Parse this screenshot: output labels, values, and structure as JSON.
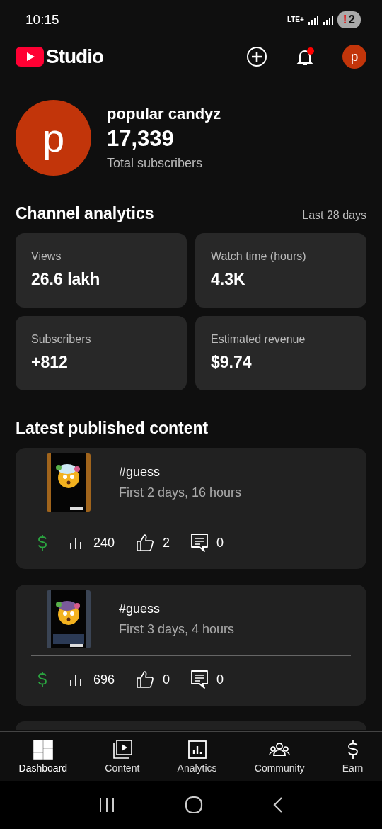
{
  "status_bar": {
    "time": "10:15",
    "network": "LTE+",
    "alert_mark": "!",
    "alert_count": "2"
  },
  "app_bar": {
    "title": "Studio",
    "avatar_letter": "p",
    "notification_dot": true
  },
  "channel": {
    "avatar_letter": "p",
    "name": "popular candyz",
    "subscribers": "17,339",
    "subscribers_label": "Total subscribers"
  },
  "analytics": {
    "title": "Channel analytics",
    "period": "Last 28 days",
    "metrics": [
      {
        "label": "Views",
        "value": "26.6 lakh"
      },
      {
        "label": "Watch time (hours)",
        "value": "4.3K"
      },
      {
        "label": "Subscribers",
        "value": "+812"
      },
      {
        "label": "Estimated revenue",
        "value": "$9.74"
      }
    ]
  },
  "latest": {
    "title": "Latest published content",
    "items": [
      {
        "kind": "picture",
        "title": "#guess",
        "period": "First 2 days, 16 hours",
        "views": "240",
        "likes": "2",
        "comments": "0"
      },
      {
        "kind": "picture",
        "title": "#guess",
        "period": "First 3 days, 4 hours",
        "views": "696",
        "likes": "0",
        "comments": "0"
      }
    ]
  },
  "bottom_nav": [
    {
      "label": "Dashboard",
      "selected": true
    },
    {
      "label": "Content",
      "selected": false
    },
    {
      "label": "Analytics",
      "selected": false
    },
    {
      "label": "Community",
      "selected": false
    },
    {
      "label": "Earn",
      "selected": false
    }
  ]
}
